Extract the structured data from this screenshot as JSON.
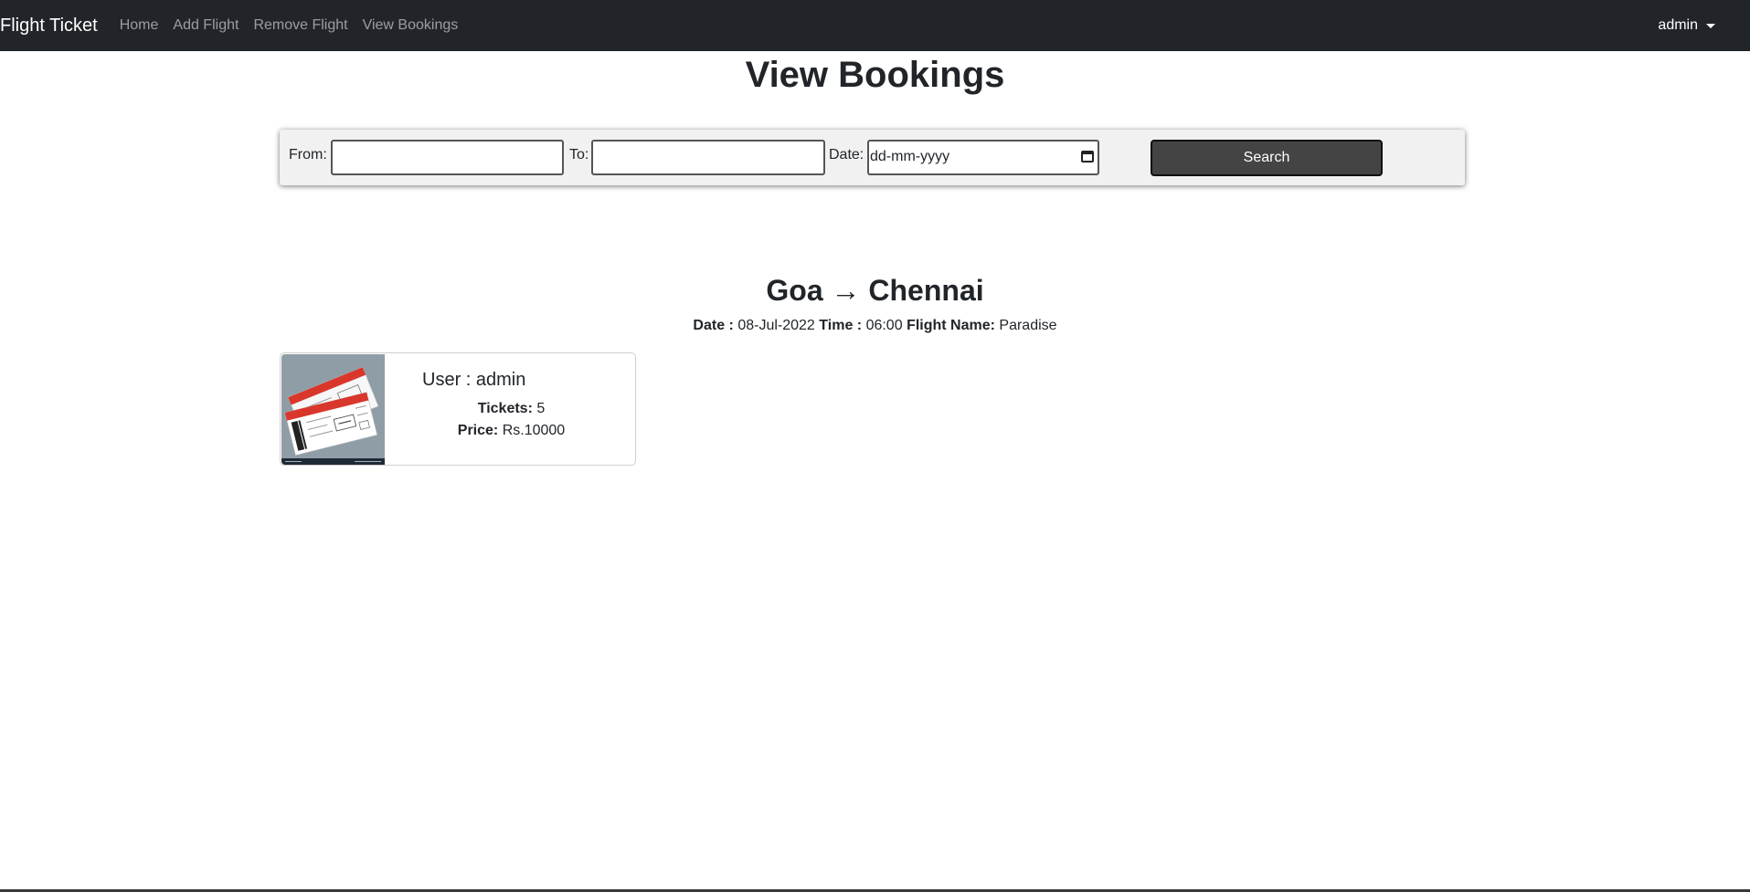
{
  "navbar": {
    "brand": "Flight Ticket",
    "links": [
      "Home",
      "Add Flight",
      "Remove Flight",
      "View Bookings"
    ],
    "user": "admin"
  },
  "page": {
    "title": "View Bookings"
  },
  "search": {
    "from_label": "From:",
    "from_value": "",
    "to_label": "To:",
    "to_value": "",
    "date_label": "Date:",
    "date_placeholder": "dd-mm-yyyy",
    "button_label": "Search"
  },
  "booking_group": {
    "route": "Goa → Chennai",
    "date_label": "Date :",
    "date_value": "08-Jul-2022",
    "time_label": "Time :",
    "time_value": "06:00",
    "flight_label": "Flight Name:",
    "flight_value": "Paradise",
    "bookings": [
      {
        "user": "User : admin",
        "tickets_label": "Tickets:",
        "tickets_value": "5",
        "price_label": "Price:",
        "price_value": "Rs.10000"
      }
    ]
  },
  "colors": {
    "navbar_bg": "#212529",
    "search_panel_bg": "#f1f1f1",
    "search_button_bg": "#444444",
    "ticket_red": "#d9372b"
  }
}
